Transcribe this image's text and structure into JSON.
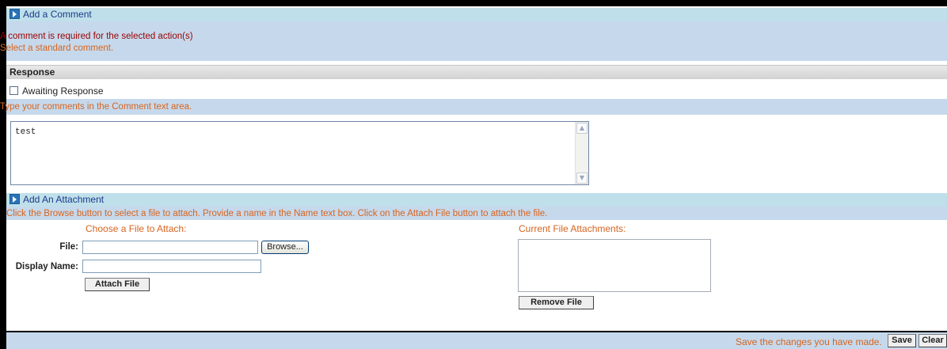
{
  "add_comment": {
    "header": "Add a Comment",
    "error": "A comment is required for the selected action(s)",
    "hint": "Select a standard comment."
  },
  "response": {
    "header": "Response",
    "awaiting_label": "Awaiting Response",
    "awaiting_checked": false,
    "hint": "Type your comments in the Comment text area.",
    "comment_value": "test"
  },
  "attachment": {
    "header": "Add An Attachment",
    "hint": "Click the Browse button to select a file to attach. Provide a name in the Name text box. Click on the Attach File button to attach the file.",
    "choose_heading": "Choose a File to Attach:",
    "file_label": "File:",
    "file_value": "",
    "browse_label": "Browse...",
    "display_name_label": "Display Name:",
    "display_name_value": "",
    "attach_button": "Attach File",
    "current_heading": "Current File Attachments:",
    "current_items": [],
    "remove_button": "Remove File"
  },
  "footer": {
    "message": "Save the changes you have made.",
    "save_label": "Save",
    "clear_label": "Clear"
  },
  "colors": {
    "header_bg": "#bfe0ea",
    "light_blue": "#c6d9ec",
    "orange_text": "#d7641e",
    "error_text": "#9a0000"
  }
}
